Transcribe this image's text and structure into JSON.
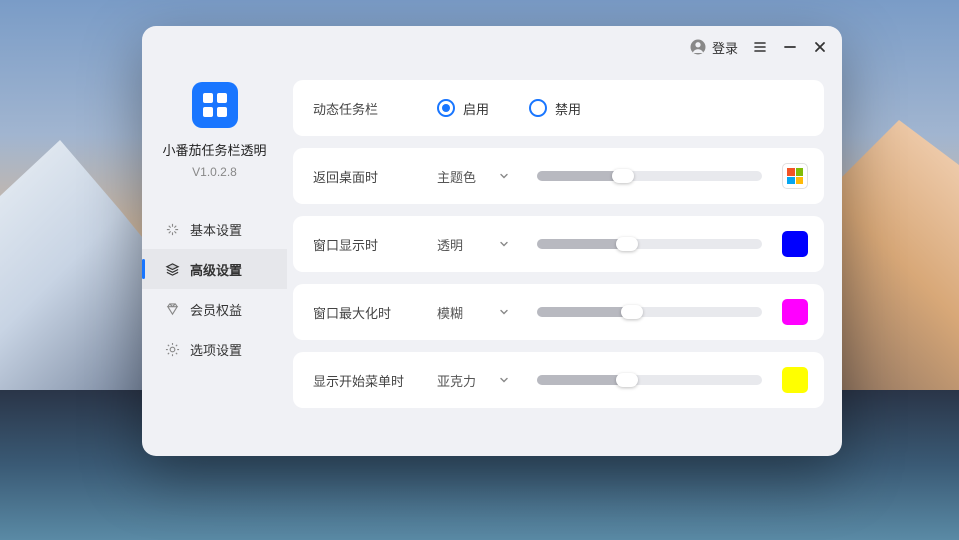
{
  "titlebar": {
    "login": "登录"
  },
  "app": {
    "name": "小番茄任务栏透明",
    "version": "V1.0.2.8"
  },
  "nav": {
    "items": [
      {
        "label": "基本设置",
        "icon": "sparkle"
      },
      {
        "label": "高级设置",
        "icon": "layers"
      },
      {
        "label": "会员权益",
        "icon": "diamond"
      },
      {
        "label": "选项设置",
        "icon": "gear"
      }
    ]
  },
  "content": {
    "dynamic_taskbar": {
      "label": "动态任务栏",
      "enable": "启用",
      "disable": "禁用"
    },
    "rows": [
      {
        "label": "返回桌面时",
        "dropdown": "主题色",
        "slider": 38,
        "swatch_type": "ms"
      },
      {
        "label": "窗口显示时",
        "dropdown": "透明",
        "slider": 40,
        "swatch_color": "#0000ff"
      },
      {
        "label": "窗口最大化时",
        "dropdown": "模糊",
        "slider": 42,
        "swatch_color": "#ff00ff"
      },
      {
        "label": "显示开始菜单时",
        "dropdown": "亚克力",
        "slider": 40,
        "swatch_color": "#ffff00"
      }
    ]
  }
}
